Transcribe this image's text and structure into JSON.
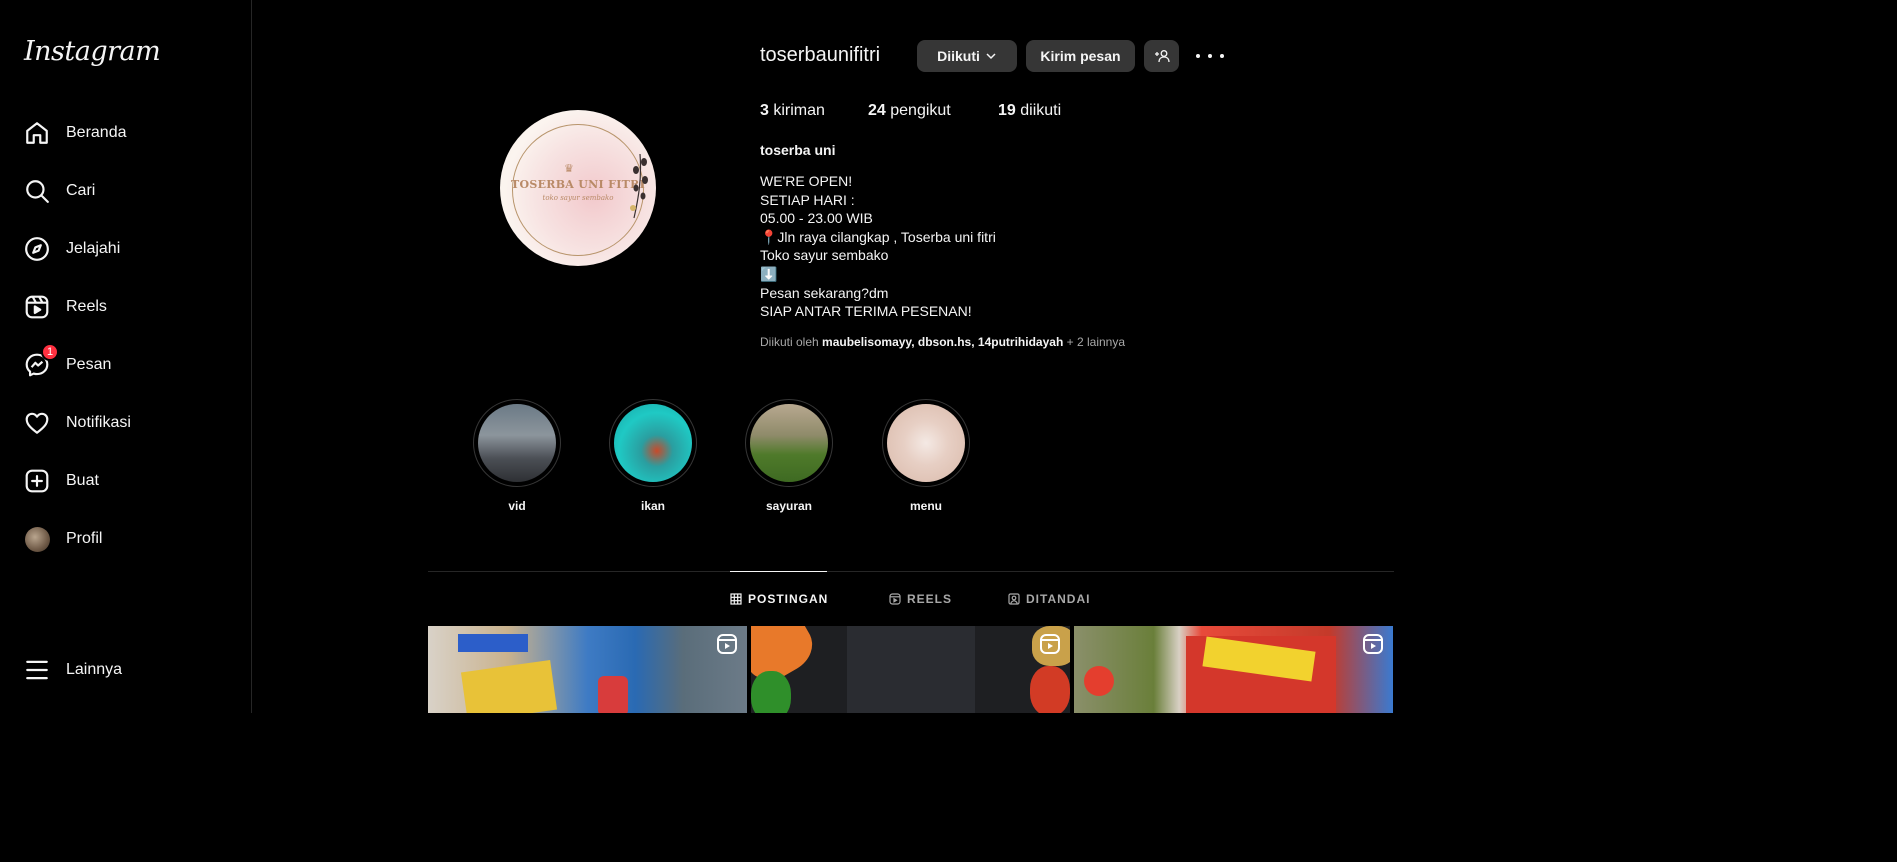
{
  "sidebar": {
    "logo": "Instagram",
    "items": [
      {
        "label": "Beranda",
        "icon": "home-icon"
      },
      {
        "label": "Cari",
        "icon": "search-icon"
      },
      {
        "label": "Jelajahi",
        "icon": "compass-icon"
      },
      {
        "label": "Reels",
        "icon": "reels-icon"
      },
      {
        "label": "Pesan",
        "icon": "messenger-icon",
        "badge": "1"
      },
      {
        "label": "Notifikasi",
        "icon": "heart-icon"
      },
      {
        "label": "Buat",
        "icon": "plus-square-icon"
      },
      {
        "label": "Profil",
        "icon": "avatar"
      }
    ],
    "more_label": "Lainnya"
  },
  "profile": {
    "username": "toserbaunifitri",
    "following_button": "Diikuti",
    "message_button": "Kirim pesan",
    "logo_text": "TOSERBA UNI FITRI",
    "logo_subtext": "toko sayur sembako",
    "stats": {
      "posts_count": "3",
      "posts_label": "kiriman",
      "followers_count": "24",
      "followers_label": "pengikut",
      "following_count": "19",
      "following_label": "diikuti"
    },
    "full_name": "toserba uni",
    "bio_lines": [
      "WE'RE OPEN!",
      "SETIAP HARI :",
      "05.00 - 23.00 WIB",
      "📍Jln raya cilangkap , Toserba uni fitri",
      "Toko sayur sembako",
      "⬇️",
      "Pesan sekarang?dm",
      "SIAP ANTAR TERIMA PESENAN!"
    ],
    "followed_by": {
      "prefix": "Diikuti oleh",
      "users": [
        "maubelisomayy",
        "dbson.hs",
        "14putrihidayah"
      ],
      "suffix": "+ 2 lainnya"
    }
  },
  "highlights": [
    {
      "label": "vid"
    },
    {
      "label": "ikan"
    },
    {
      "label": "sayuran"
    },
    {
      "label": "menu"
    }
  ],
  "tabs": [
    {
      "label": "POSTINGAN",
      "active": true
    },
    {
      "label": "REELS",
      "active": false
    },
    {
      "label": "DITANDAI",
      "active": false
    }
  ],
  "colors": {
    "background": "#000000",
    "button": "#363636",
    "badge": "#ff3040",
    "secondary_text": "#a8a8a8"
  }
}
